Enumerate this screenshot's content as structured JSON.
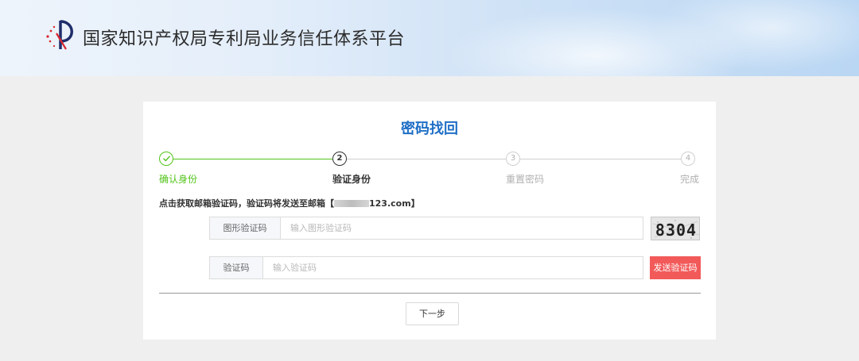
{
  "header": {
    "site_title": "国家知识产权局专利局业务信任体系平台",
    "logo_icon": "cnipa-logo-icon"
  },
  "page": {
    "title": "密码找回"
  },
  "steps": [
    {
      "number": "1",
      "label": "确认身份",
      "state": "done"
    },
    {
      "number": "2",
      "label": "验证身份",
      "state": "active"
    },
    {
      "number": "3",
      "label": "重置密码",
      "state": "pending"
    },
    {
      "number": "4",
      "label": "完成",
      "state": "pending"
    }
  ],
  "notice": {
    "prefix": "点击获取邮箱验证码，验证码将发送至邮箱【",
    "email_visible": "123.com",
    "suffix": "】"
  },
  "form": {
    "image_captcha": {
      "label": "图形验证码",
      "placeholder": "输入图形验证码",
      "value": ""
    },
    "captcha_image_text": "8304",
    "code": {
      "label": "验证码",
      "placeholder": "输入验证码",
      "value": ""
    },
    "send_button": "发送验证码",
    "next_button": "下一步"
  },
  "colors": {
    "accent": "#1f6fc6",
    "success": "#52c41a",
    "danger": "#f25a5a"
  }
}
